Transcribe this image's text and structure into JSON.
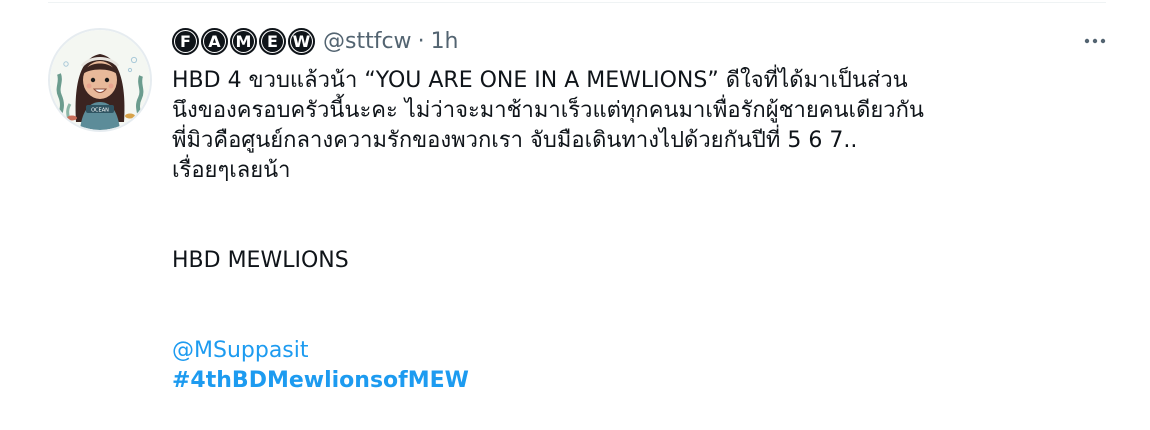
{
  "tweet": {
    "display_name_letters": [
      "F",
      "A",
      "M",
      "E",
      "W"
    ],
    "handle": "@sttfcw",
    "separator": "·",
    "time": "1h",
    "more_icon": "more-horizontal-icon",
    "avatar_label": "OCEAN",
    "text_lines": [
      "HBD 4 ขวบแล้วน้า “YOU ARE ONE IN A MEWLIONS” ดีใจที่ได้มาเป็นส่วน",
      "นึงของครอบครัวนี้นะคะ ไม่ว่าจะมาช้ามาเร็วแต่ทุกคนมาเพื่อรักผู้ชายคนเดียวกัน",
      "พี่มิวคือศูนย์กลางความรักของพวกเรา จับมือเดินทางไปด้วยกันปีที่ 5 6 7..",
      "เรื่อยๆเลยน้า"
    ],
    "second_paragraph": "HBD MEWLIONS",
    "mention": "@MSuppasit",
    "hashtag": "#4thBDMewlionsofMEW",
    "colors": {
      "text": "#0f1419",
      "secondary": "#536471",
      "link": "#1d9bf0"
    }
  }
}
